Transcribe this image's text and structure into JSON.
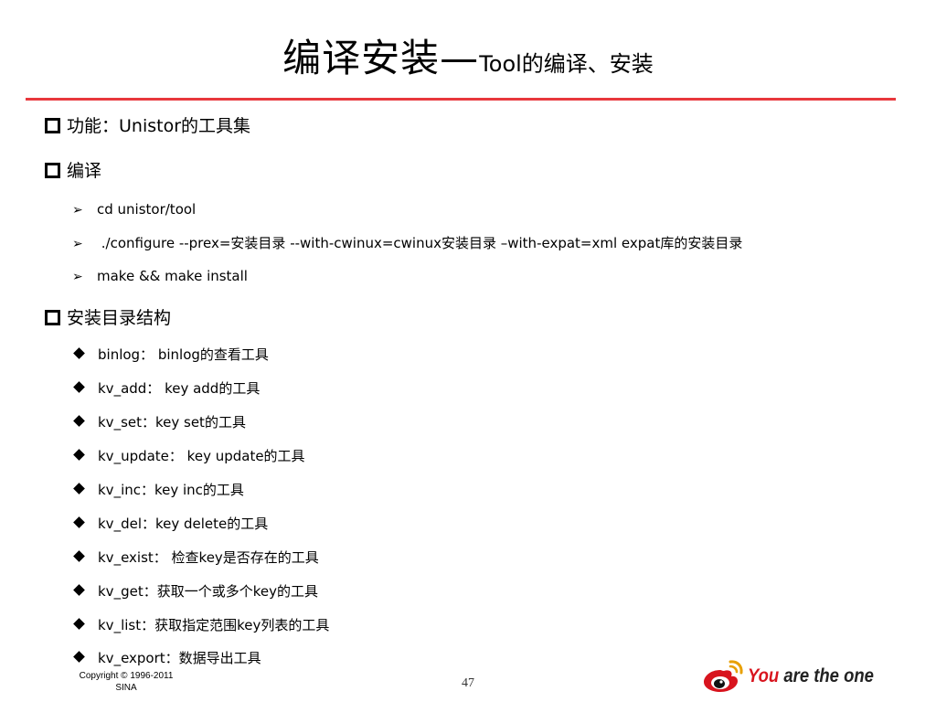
{
  "title": {
    "main": "编译安装—",
    "sub": "Tool的编译、安装"
  },
  "sections": [
    {
      "heading": "功能：Unistor的工具集",
      "items": []
    },
    {
      "heading": "编译",
      "items": [
        "cd  unistor/tool",
        " ./configure  --prex=安装目录  --with-cwinux=cwinux安装目录  –with-expat=xml expat库的安装目录",
        "make  && make install"
      ]
    },
    {
      "heading": "安装目录结构",
      "items": [
        "binlog： binlog的查看工具",
        "kv_add： key  add的工具",
        "kv_set：key set的工具",
        "kv_update： key  update的工具",
        "kv_inc：key  inc的工具",
        "kv_del：key delete的工具",
        "kv_exist： 检查key是否存在的工具",
        "kv_get：获取一个或多个key的工具",
        "kv_list：获取指定范围key列表的工具",
        "kv_export：数据导出工具"
      ]
    }
  ],
  "footer": {
    "copyright_line1": "Copyright © 1996-2011",
    "copyright_line2": "SINA",
    "page_number": "47",
    "logo_you": "You",
    "logo_rest": " are the one"
  },
  "colors": {
    "accent_rule": "#e8383d",
    "logo_red": "#d8141e"
  },
  "icons": {
    "level1_bullet": "hollow-square-icon",
    "compile_bullet": "arrowhead-icon",
    "dir_bullet": "diamond-icon"
  }
}
